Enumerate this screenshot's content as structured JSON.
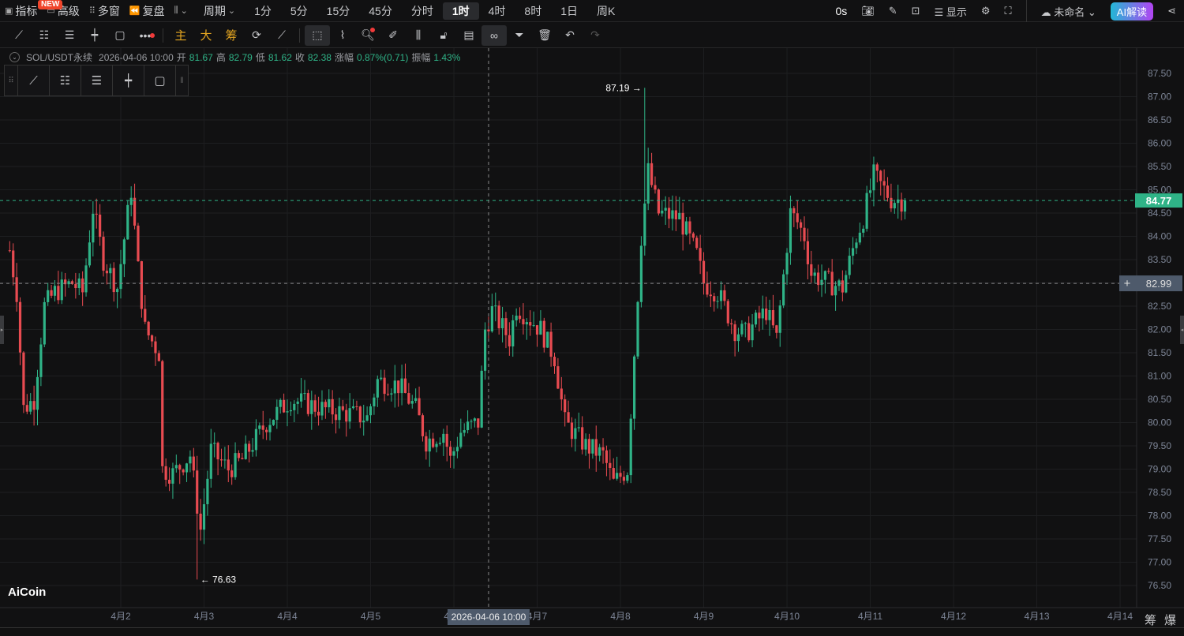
{
  "topbar": {
    "indicators": "指标",
    "new_badge": "NEW",
    "advanced": "高级",
    "multi_window": "多窗",
    "replay": "复盘",
    "period": "周期",
    "periods": [
      "1分",
      "5分",
      "15分",
      "45分",
      "分时",
      "1时",
      "4时",
      "8时",
      "1日",
      "周K"
    ],
    "active_period": "1时",
    "countdown": "0s",
    "display": "显示",
    "layout_name": "未命名",
    "ai": "AI解读"
  },
  "toolbar": {
    "main": "主",
    "big": "大",
    "chips": "筹"
  },
  "info": {
    "symbol": "SOL/USDT永续",
    "datetime": "2026-04-06 10:00",
    "open_label": "开",
    "open": "81.67",
    "high_label": "高",
    "high": "82.79",
    "low_label": "低",
    "low": "81.62",
    "close_label": "收",
    "close": "82.38",
    "change_label": "涨幅",
    "change": "0.87%(0.71)",
    "amp_label": "振幅",
    "amp": "1.43%"
  },
  "logo": "AiCoin",
  "xaxis_extra": [
    "筹",
    "爆"
  ],
  "chart_data": {
    "type": "candlestick",
    "interval": "1h",
    "y_ticks": [
      "76.50",
      "77.00",
      "77.50",
      "78.00",
      "78.50",
      "79.00",
      "79.50",
      "80.00",
      "80.50",
      "81.00",
      "81.50",
      "82.00",
      "82.50",
      "83.00",
      "83.50",
      "84.00",
      "84.50",
      "85.00",
      "85.50",
      "86.00",
      "86.50",
      "87.00",
      "87.50"
    ],
    "ylim": [
      76.5,
      87.5
    ],
    "x_ticks": [
      "4月2",
      "4月3",
      "4月4",
      "4月5",
      "4月6",
      "4月7",
      "4月8",
      "4月9",
      "4月10",
      "4月11",
      "4月12",
      "4月13",
      "4月14"
    ],
    "first_tick_hour": 32,
    "keypoints": [
      [
        0,
        83.7
      ],
      [
        2,
        82.8
      ],
      [
        4,
        80.3
      ],
      [
        7,
        80.5
      ],
      [
        10,
        82.5
      ],
      [
        13,
        82.8
      ],
      [
        18,
        83.0
      ],
      [
        21,
        82.8
      ],
      [
        24,
        84.6
      ],
      [
        27,
        83.5
      ],
      [
        31,
        82.9
      ],
      [
        35,
        85.0
      ],
      [
        37,
        83.3
      ],
      [
        39,
        82.0
      ],
      [
        43,
        81.5
      ],
      [
        44,
        79.0
      ],
      [
        47,
        78.9
      ],
      [
        52,
        79.3
      ],
      [
        55,
        77.7
      ],
      [
        58,
        79.4
      ],
      [
        63,
        79.0
      ],
      [
        67,
        79.2
      ],
      [
        74,
        80.0
      ],
      [
        81,
        80.5
      ],
      [
        90,
        80.3
      ],
      [
        97,
        80.2
      ],
      [
        103,
        80.1
      ],
      [
        106,
        80.9
      ],
      [
        112,
        80.8
      ],
      [
        117,
        80.3
      ],
      [
        120,
        79.6
      ],
      [
        125,
        79.8
      ],
      [
        127,
        79.2
      ],
      [
        130,
        79.8
      ],
      [
        135,
        80.0
      ],
      [
        137,
        82.0
      ],
      [
        139,
        82.4
      ],
      [
        144,
        81.8
      ],
      [
        146,
        82.5
      ],
      [
        153,
        82.0
      ],
      [
        157,
        81.4
      ],
      [
        160,
        80.0
      ],
      [
        166,
        79.5
      ],
      [
        171,
        79.3
      ],
      [
        174,
        78.7
      ],
      [
        178,
        79.0
      ],
      [
        180,
        81.5
      ],
      [
        182,
        84.0
      ],
      [
        184,
        85.4
      ],
      [
        187,
        84.5
      ],
      [
        193,
        84.4
      ],
      [
        198,
        83.6
      ],
      [
        200,
        83.0
      ],
      [
        204,
        82.8
      ],
      [
        209,
        82.0
      ],
      [
        212,
        81.9
      ],
      [
        218,
        82.4
      ],
      [
        221,
        81.8
      ],
      [
        225,
        84.5
      ],
      [
        227,
        84.3
      ],
      [
        229,
        84.0
      ],
      [
        231,
        83.2
      ],
      [
        236,
        83.0
      ],
      [
        240,
        82.9
      ],
      [
        244,
        84.0
      ],
      [
        246,
        84.4
      ],
      [
        249,
        85.3
      ],
      [
        254,
        84.8
      ],
      [
        258,
        84.77
      ]
    ],
    "max": {
      "hour": 183,
      "price": 87.19,
      "label": "87.19 →"
    },
    "min": {
      "hour": 54,
      "price": 76.63,
      "label": "← 76.63"
    },
    "last_price": "84.77",
    "crosshair": {
      "hour": 138,
      "price": "82.99",
      "time": "2026-04-06 10:00"
    },
    "colors": {
      "up": "#2fb387",
      "down": "#e84b51",
      "bg": "#111112",
      "grid": "#1e1f21"
    }
  }
}
